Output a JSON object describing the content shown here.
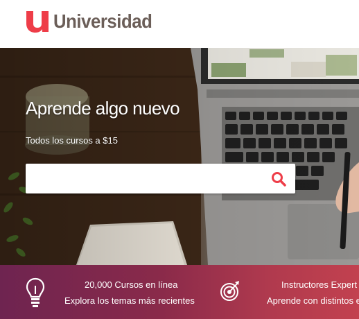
{
  "brand": {
    "name": "Universidad",
    "accent_color": "#ee3d48",
    "logo_icon": "u-logo-icon"
  },
  "hero": {
    "title": "Aprende algo nuevo",
    "subtitle": "Todos los cursos a $15",
    "search": {
      "value": "",
      "placeholder": "",
      "button_icon": "search-icon",
      "button_color": "#ee3d48"
    }
  },
  "features": [
    {
      "icon": "lightbulb-icon",
      "title": "20,000 Cursos en línea",
      "description": "Explora los temas más recientes"
    },
    {
      "icon": "target-icon",
      "title": "Instructores Expert",
      "description": "Aprende con distintos e"
    }
  ]
}
